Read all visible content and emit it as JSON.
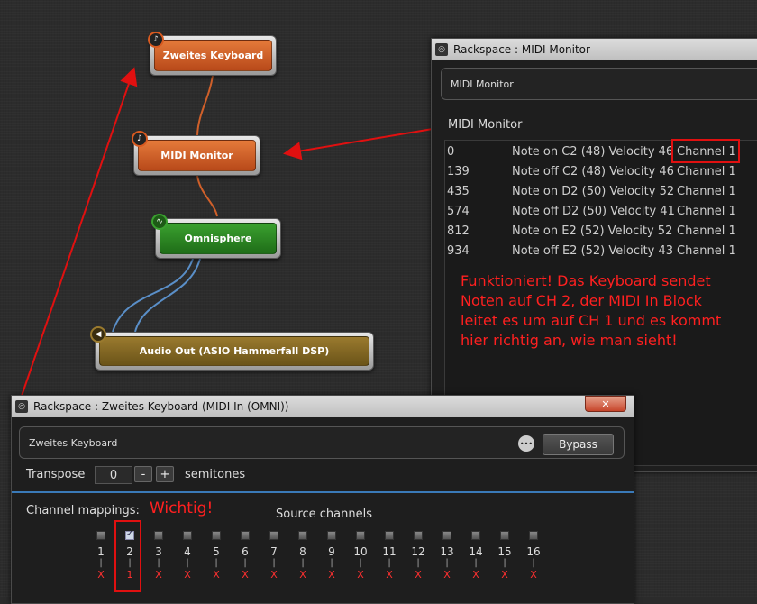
{
  "blocks": {
    "zweites_keyboard": "Zweites Keyboard",
    "midi_monitor": "MIDI Monitor",
    "omnisphere": "Omnisphere",
    "audio_out": "Audio Out (ASIO Hammerfall DSP)"
  },
  "monitor_window": {
    "title": "Rackspace : MIDI Monitor",
    "header": "MIDI Monitor",
    "section_label": "MIDI Monitor",
    "rows": [
      {
        "time": "0",
        "event": "Note on C2 (48) Velocity 46",
        "channel": "Channel 1"
      },
      {
        "time": "139",
        "event": "Note off C2 (48) Velocity 46",
        "channel": "Channel 1"
      },
      {
        "time": "435",
        "event": "Note on D2 (50) Velocity 52",
        "channel": "Channel 1"
      },
      {
        "time": "574",
        "event": "Note off D2 (50) Velocity 41",
        "channel": "Channel 1"
      },
      {
        "time": "812",
        "event": "Note on E2 (52) Velocity 52",
        "channel": "Channel 1"
      },
      {
        "time": "934",
        "event": "Note off E2 (52) Velocity 43",
        "channel": "Channel 1"
      }
    ],
    "annotation": [
      "Funktioniert! Das Keyboard sendet",
      "Noten auf CH 2, der MIDI In Block",
      "leitet es um auf CH 1 und es kommt",
      "hier richtig an, wie man sieht!"
    ]
  },
  "keyboard_window": {
    "title": "Rackspace : Zweites Keyboard (MIDI In (OMNI))",
    "close_label": "✕",
    "header": "Zweites Keyboard",
    "more_label": "•••",
    "bypass_label": "Bypass",
    "transpose_label": "Transpose",
    "transpose_value": "0",
    "minus_label": "-",
    "plus_label": "+",
    "semitones_label": "semitones",
    "channel_mappings_label": "Channel mappings:",
    "annotation": "Wichtig!",
    "source_channels_label": "Source channels",
    "channels": [
      {
        "num": "1",
        "target": "X",
        "checked": false
      },
      {
        "num": "2",
        "target": "1",
        "checked": true
      },
      {
        "num": "3",
        "target": "X",
        "checked": false
      },
      {
        "num": "4",
        "target": "X",
        "checked": false
      },
      {
        "num": "5",
        "target": "X",
        "checked": false
      },
      {
        "num": "6",
        "target": "X",
        "checked": false
      },
      {
        "num": "7",
        "target": "X",
        "checked": false
      },
      {
        "num": "8",
        "target": "X",
        "checked": false
      },
      {
        "num": "9",
        "target": "X",
        "checked": false
      },
      {
        "num": "10",
        "target": "X",
        "checked": false
      },
      {
        "num": "11",
        "target": "X",
        "checked": false
      },
      {
        "num": "12",
        "target": "X",
        "checked": false
      },
      {
        "num": "13",
        "target": "X",
        "checked": false
      },
      {
        "num": "14",
        "target": "X",
        "checked": false
      },
      {
        "num": "15",
        "target": "X",
        "checked": false
      },
      {
        "num": "16",
        "target": "X",
        "checked": false
      }
    ]
  },
  "colors": {
    "annotation": "#ff2020",
    "orange_block": "#d0602a",
    "green_block": "#2f8a25",
    "olive_block": "#8a6c25"
  }
}
